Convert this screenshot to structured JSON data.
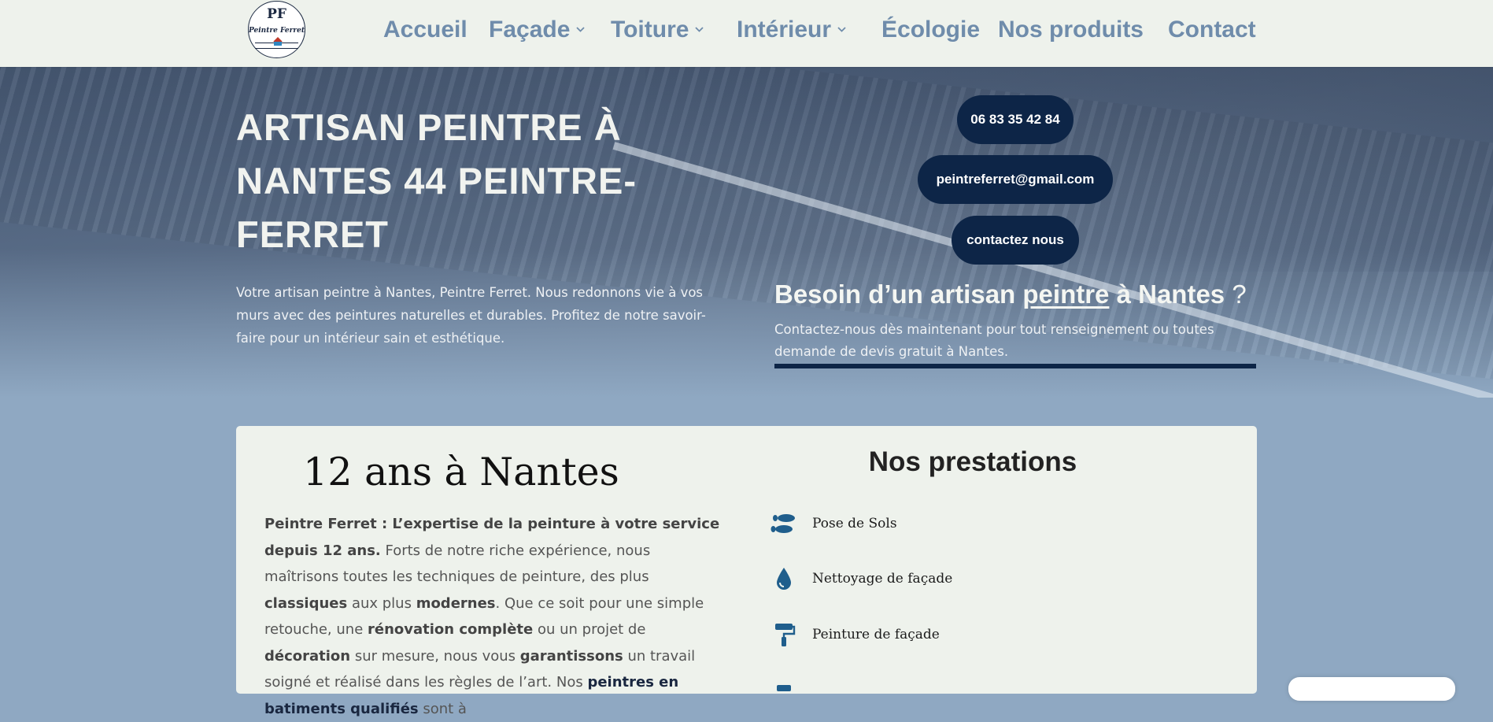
{
  "logo": {
    "monogram": "PF",
    "name": "Peintre Ferret"
  },
  "nav": [
    {
      "label": "Accueil",
      "dropdown": false
    },
    {
      "label": "Façade",
      "dropdown": true
    },
    {
      "label": "Toiture",
      "dropdown": true
    },
    {
      "label": "Intérieur",
      "dropdown": true
    },
    {
      "label": "Écologie",
      "dropdown": false
    },
    {
      "label": "Nos produits",
      "dropdown": false
    },
    {
      "label": "Contact",
      "dropdown": false
    }
  ],
  "hero": {
    "title": "ARTISAN PEINTRE À NANTES 44 PEINTRE-FERRET",
    "intro": "Votre artisan peintre à Nantes, Peintre Ferret. Nous redonnons vie à vos murs avec des peintures naturelles et durables. Profitez de notre savoir-faire pour un intérieur sain et esthétique.",
    "phone": "06 83 35 42 84",
    "email": "peintreferret@gmail.com",
    "contact_button": "contactez nous",
    "need_title_prefix": "Besoin d’un artisan ",
    "need_title_link": "peintre",
    "need_title_suffix": " à Nantes",
    "need_title_mark": " ?",
    "need_text": "Contactez-nous dès maintenant pour tout renseignement ou toutes demande de devis gratuit à Nantes."
  },
  "about": {
    "heading": "12 ans à Nantes",
    "lead": "Peintre Ferret : L’expertise de la peinture à votre service depuis 12 ans.",
    "t1": " Forts de notre riche expérience, nous maîtrisons toutes les techniques de peinture, des plus ",
    "b1": "classiques",
    "t2": " aux plus ",
    "b2": "modernes",
    "t3": ". Que ce soit pour une simple retouche, une ",
    "b3": "rénovation complète",
    "t4": " ou un projet de ",
    "b4": "décoration",
    "t5": " sur mesure, nous vous ",
    "b5": "garantissons",
    "t6": " un travail soigné et réalisé dans les règles de l’art. Nos ",
    "b6": "peintres en batiments qualifiés",
    "t7": " sont à"
  },
  "services": {
    "heading": "Nos prestations",
    "items": [
      {
        "label": "Pose de Sols",
        "icon": "footprints-icon"
      },
      {
        "label": "Nettoyage de façade",
        "icon": "water-drop-icon"
      },
      {
        "label": "Peinture de façade",
        "icon": "paint-roller-icon"
      }
    ]
  },
  "colors": {
    "accent_navy": "#0d2547",
    "nav_text": "#6f8cab",
    "icon_blue": "#1f5e8c",
    "card_bg": "#eef2ec"
  }
}
